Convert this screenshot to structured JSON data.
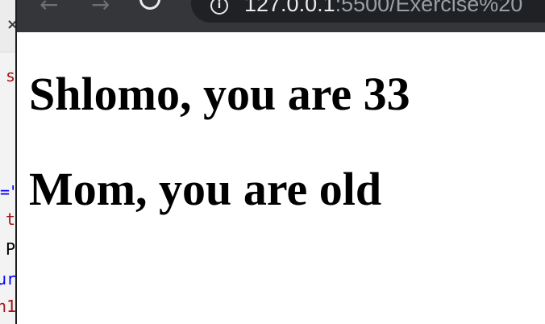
{
  "browser": {
    "back_label": "←",
    "forward_label": "→",
    "info_label": "i",
    "url_host": "127.0.0.1",
    "url_path": ":5500/Exercise%20"
  },
  "page": {
    "headings": [
      "Shlomo, you are 33",
      "Mom, you are old"
    ]
  },
  "editor": {
    "close_label": "×",
    "fragments": [
      "s",
      "=\"",
      "t",
      "P",
      "ur",
      "h1"
    ],
    "colors": {
      "string": "#a31515",
      "keyword": "#0000ff",
      "text": "#000000"
    }
  }
}
